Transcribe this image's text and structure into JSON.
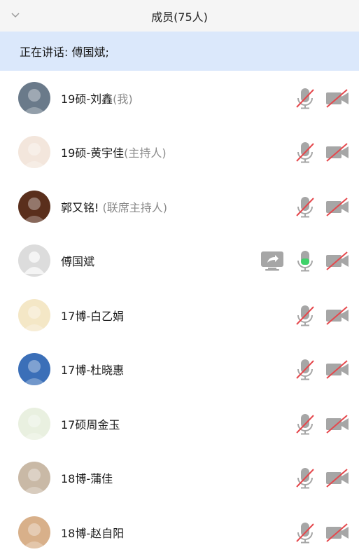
{
  "header": {
    "title": "成员(75人)",
    "collapse_icon": "chevron-down-icon"
  },
  "speaking": {
    "text": "正在讲话: 傅国斌;"
  },
  "members": [
    {
      "name": "19硕-刘鑫",
      "role": "(我)",
      "mic": "muted",
      "cam": "off",
      "sharing": false,
      "avatar_color": "#6a7a8a"
    },
    {
      "name": "19硕-黄宇佳",
      "role": "(主持人)",
      "mic": "muted",
      "cam": "off",
      "sharing": false,
      "avatar_color": "#f3e6dc"
    },
    {
      "name": "郭又铭!",
      "role": " (联席主持人)",
      "mic": "muted",
      "cam": "off",
      "sharing": false,
      "avatar_color": "#5a2f1c"
    },
    {
      "name": "傅国斌",
      "role": "",
      "mic": "active",
      "cam": "off",
      "sharing": true,
      "avatar_color": "#d9d9d9"
    },
    {
      "name": "17博-白乙娟",
      "role": "",
      "mic": "muted",
      "cam": "off",
      "sharing": false,
      "avatar_color": "#f4e7c6"
    },
    {
      "name": "17博-杜晓惠",
      "role": "",
      "mic": "muted",
      "cam": "off",
      "sharing": false,
      "avatar_color": "#3b6fb8"
    },
    {
      "name": "17硕周金玉",
      "role": "",
      "mic": "muted",
      "cam": "off",
      "sharing": false,
      "avatar_color": "#e9f0e0"
    },
    {
      "name": "18博-蒲佳",
      "role": "",
      "mic": "muted",
      "cam": "off",
      "sharing": false,
      "avatar_color": "#c9b9a6"
    },
    {
      "name": "18博-赵自阳",
      "role": "",
      "mic": "muted",
      "cam": "off",
      "sharing": false,
      "avatar_color": "#d8b08a"
    }
  ],
  "colors": {
    "header_bg": "#f5f5f5",
    "speaking_bg": "#dbe8fb",
    "icon_gray": "#a6a6a6",
    "muted_slash": "#e5484d",
    "mic_active": "#3fd26a"
  }
}
